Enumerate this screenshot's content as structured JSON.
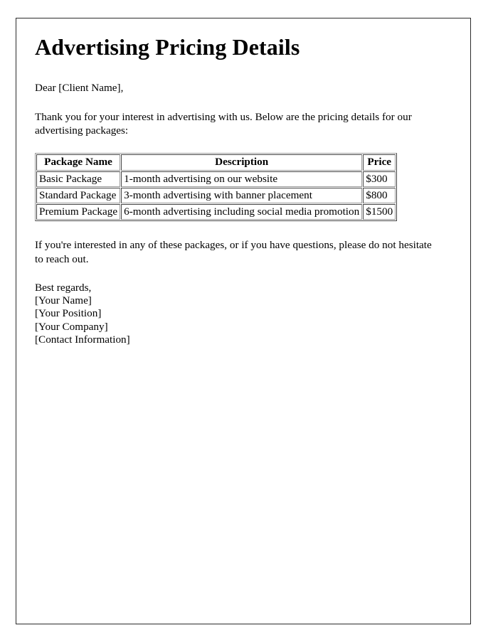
{
  "document": {
    "title": "Advertising Pricing Details",
    "salutation": "Dear [Client Name],",
    "intro_paragraph": "Thank you for your interest in advertising with us. Below are the pricing details for our advertising packages:",
    "closing_paragraph": "If you're interested in any of these packages, or if you have questions, please do not hesitate to reach out."
  },
  "pricing_table": {
    "headers": {
      "package_name": "Package Name",
      "description": "Description",
      "price": "Price"
    },
    "rows": [
      {
        "package_name": "Basic Package",
        "description": "1-month advertising on our website",
        "price": "$300"
      },
      {
        "package_name": "Standard Package",
        "description": "3-month advertising with banner placement",
        "price": "$800"
      },
      {
        "package_name": "Premium Package",
        "description": "6-month advertising including social media promotion",
        "price": "$1500"
      }
    ]
  },
  "signature": {
    "closing": "Best regards,",
    "name": "[Your Name]",
    "position": "[Your Position]",
    "company": "[Your Company]",
    "contact": "[Contact Information]"
  },
  "colors": {
    "page_border": "#2b2b2b",
    "text": "#000000",
    "table_border": "#9a9a9a",
    "background": "#ffffff"
  }
}
